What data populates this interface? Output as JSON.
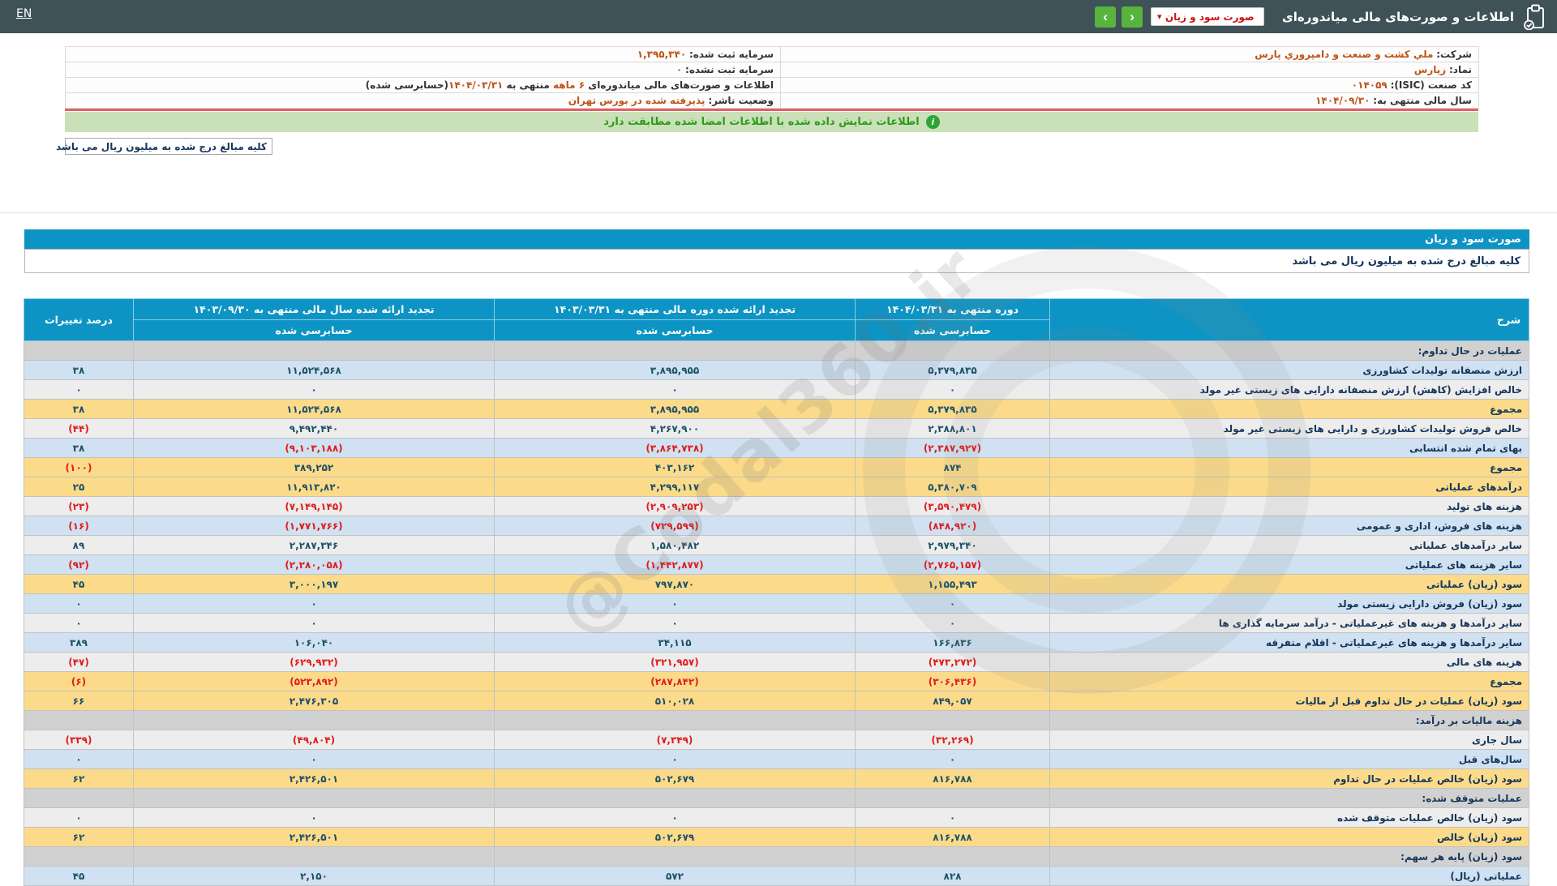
{
  "topbar": {
    "en_label": "EN",
    "title": "اطلاعات و صورت‌های مالی میاندوره‌ای",
    "report_select_value": "صورت سود و زیان",
    "nav_next": "›",
    "nav_prev": "‹",
    "select_arrow": "▾"
  },
  "company_info": {
    "rows": [
      {
        "r_label": "شرکت:",
        "r_value": "ملي کشت و صنعت و دامپروري پارس",
        "l_label": "سرمایه ثبت شده:",
        "l_value": "۱,۳۹۵,۳۴۰"
      },
      {
        "r_label": "نماد:",
        "r_value": "زپارس",
        "l_label": "سرمایه ثبت نشده:",
        "l_value": "۰"
      },
      {
        "r_label": "کد صنعت (ISIC):",
        "r_value": "۰۱۴۰۵۹"
      },
      {
        "r_label": "سال مالی منتهی به:",
        "r_value": "۱۴۰۴/۰۹/۳۰",
        "l_label": "وضعیت ناشر:",
        "l_value": "پذیرفته شده در بورس تهران"
      }
    ],
    "period_note": {
      "prefix": "اطلاعات و صورت‌های مالی میاندوره‌ای ",
      "duration": "۶ ماهه",
      "middle": " منتهی به ",
      "date": "۱۴۰۴/۰۳/۳۱",
      "suffix": "(حسابرسی شده)"
    }
  },
  "signature_bar": {
    "text": "اطلاعات نمایش داده شده با اطلاعات امضا شده مطابقت دارد",
    "icon": "i"
  },
  "units_note": "کلیه مبالغ درج شده به میلیون ریال می باشد",
  "statement": {
    "title": "صورت سود و زیان",
    "units_note": "کلیه مبالغ درج شده به میلیون ریال می باشد",
    "columns": {
      "description": "شرح",
      "current": {
        "title": "دوره منتهی به ۱۴۰۴/۰۳/۳۱",
        "sub": "حسابرسی شده"
      },
      "restated_period": {
        "title": "تجدید ارائه شده دوره مالی منتهی به ۱۴۰۳/۰۳/۳۱",
        "sub": "حسابرسی شده"
      },
      "restated_year": {
        "title": "تجدید ارائه شده سال مالی منتهی به ۱۴۰۳/۰۹/۳۰",
        "sub": "حسابرسی شده"
      },
      "pct_change": "درصد تغییرات"
    },
    "rows": [
      {
        "type": "section",
        "label": "عملیات در حال تداوم:",
        "current": "",
        "restated_period": "",
        "restated_year": "",
        "pct": ""
      },
      {
        "type": "blue",
        "label": "ارزش منصفانه تولیدات کشاورزی",
        "current": "۵,۳۷۹,۸۳۵",
        "restated_period": "۳,۸۹۵,۹۵۵",
        "restated_year": "۱۱,۵۲۴,۵۶۸",
        "pct": "۳۸"
      },
      {
        "type": "gray",
        "label": "خالص افزایش (کاهش) ارزش منصفانه دارایی های زیستی غیر مولد",
        "current": "۰",
        "restated_period": "۰",
        "restated_year": "۰",
        "pct": "۰"
      },
      {
        "type": "yellow",
        "label": "مجموع",
        "current": "۵,۳۷۹,۸۳۵",
        "restated_period": "۳,۸۹۵,۹۵۵",
        "restated_year": "۱۱,۵۲۴,۵۶۸",
        "pct": "۳۸"
      },
      {
        "type": "gray",
        "label": "خالص فروش تولیدات کشاورزی و دارایی های زیستی غیر مولد",
        "current": "۲,۳۸۸,۸۰۱",
        "restated_period": "۴,۲۶۷,۹۰۰",
        "restated_year": "۹,۴۹۲,۴۴۰",
        "pct": "(۴۴)"
      },
      {
        "type": "blue",
        "label": "بهای تمام شده انتسابی",
        "current": "(۲,۳۸۷,۹۲۷)",
        "restated_period": "(۳,۸۶۴,۷۳۸)",
        "restated_year": "(۹,۱۰۳,۱۸۸)",
        "pct": "۳۸"
      },
      {
        "type": "yellow",
        "label": "مجموع",
        "current": "۸۷۴",
        "restated_period": "۴۰۳,۱۶۲",
        "restated_year": "۳۸۹,۲۵۲",
        "pct": "(۱۰۰)"
      },
      {
        "type": "yellow",
        "label": "درآمدهای عملیاتی",
        "current": "۵,۳۸۰,۷۰۹",
        "restated_period": "۴,۲۹۹,۱۱۷",
        "restated_year": "۱۱,۹۱۳,۸۲۰",
        "pct": "۲۵"
      },
      {
        "type": "gray",
        "label": "هزینه های تولید",
        "current": "(۳,۵۹۰,۴۷۹)",
        "restated_period": "(۲,۹۰۹,۲۵۳)",
        "restated_year": "(۷,۱۴۹,۱۴۵)",
        "pct": "(۲۳)"
      },
      {
        "type": "blue",
        "label": "هزینه های فروش، اداری و عمومی",
        "current": "(۸۴۸,۹۲۰)",
        "restated_period": "(۷۲۹,۵۹۹)",
        "restated_year": "(۱,۷۷۱,۷۶۶)",
        "pct": "(۱۶)"
      },
      {
        "type": "gray",
        "label": "سایر درآمدهای عملیاتی",
        "current": "۲,۹۷۹,۳۴۰",
        "restated_period": "۱,۵۸۰,۴۸۲",
        "restated_year": "۲,۲۸۷,۳۴۶",
        "pct": "۸۹"
      },
      {
        "type": "blue",
        "label": "سایر هزینه های عملیاتی",
        "current": "(۲,۷۶۵,۱۵۷)",
        "restated_period": "(۱,۴۴۲,۸۷۷)",
        "restated_year": "(۲,۲۸۰,۰۵۸)",
        "pct": "(۹۲)"
      },
      {
        "type": "yellow",
        "label": "سود (زیان) عملیاتی",
        "current": "۱,۱۵۵,۴۹۳",
        "restated_period": "۷۹۷,۸۷۰",
        "restated_year": "۳,۰۰۰,۱۹۷",
        "pct": "۴۵"
      },
      {
        "type": "blue",
        "label": "سود (زیان) فروش دارایی زیستی مولد",
        "current": "۰",
        "restated_period": "۰",
        "restated_year": "۰",
        "pct": "۰"
      },
      {
        "type": "gray",
        "label": "سایر درآمدها و هزینه های غیرعملیاتی - درآمد سرمایه گذاری ها",
        "current": "۰",
        "restated_period": "۰",
        "restated_year": "۰",
        "pct": "۰"
      },
      {
        "type": "blue",
        "label": "سایر درآمدها و هزینه های غیرعملیاتی - اقلام متفرقه",
        "current": "۱۶۶,۸۳۶",
        "restated_period": "۳۴,۱۱۵",
        "restated_year": "۱۰۶,۰۴۰",
        "pct": "۳۸۹"
      },
      {
        "type": "gray",
        "label": "هزینه های مالی",
        "current": "(۴۷۳,۲۷۲)",
        "restated_period": "(۳۲۱,۹۵۷)",
        "restated_year": "(۶۲۹,۹۳۲)",
        "pct": "(۴۷)"
      },
      {
        "type": "yellow",
        "label": "مجموع",
        "current": "(۳۰۶,۴۳۶)",
        "restated_period": "(۲۸۷,۸۴۲)",
        "restated_year": "(۵۲۳,۸۹۲)",
        "pct": "(۶)"
      },
      {
        "type": "yellow",
        "label": "سود (زیان) عملیات در حال تداوم قبل از مالیات",
        "current": "۸۴۹,۰۵۷",
        "restated_period": "۵۱۰,۰۲۸",
        "restated_year": "۲,۴۷۶,۳۰۵",
        "pct": "۶۶"
      },
      {
        "type": "section",
        "label": "هزینه مالیات بر درآمد:",
        "current": "",
        "restated_period": "",
        "restated_year": "",
        "pct": ""
      },
      {
        "type": "gray",
        "label": "سال جاری",
        "current": "(۳۲,۲۶۹)",
        "restated_period": "(۷,۳۴۹)",
        "restated_year": "(۴۹,۸۰۴)",
        "pct": "(۳۳۹)"
      },
      {
        "type": "blue",
        "label": "سال‌های قبل",
        "current": "۰",
        "restated_period": "۰",
        "restated_year": "۰",
        "pct": "۰"
      },
      {
        "type": "yellow",
        "label": "سود (زیان) خالص عملیات در حال تداوم",
        "current": "۸۱۶,۷۸۸",
        "restated_period": "۵۰۲,۶۷۹",
        "restated_year": "۲,۴۲۶,۵۰۱",
        "pct": "۶۲"
      },
      {
        "type": "section",
        "label": "عملیات متوقف شده:",
        "current": "",
        "restated_period": "",
        "restated_year": "",
        "pct": ""
      },
      {
        "type": "gray",
        "label": "سود (زیان) خالص عملیات متوقف شده",
        "current": "۰",
        "restated_period": "۰",
        "restated_year": "۰",
        "pct": "۰"
      },
      {
        "type": "yellow",
        "label": "سود (زیان) خالص",
        "current": "۸۱۶,۷۸۸",
        "restated_period": "۵۰۲,۶۷۹",
        "restated_year": "۲,۴۲۶,۵۰۱",
        "pct": "۶۲"
      },
      {
        "type": "section",
        "label": "سود (زیان) پایه هر سهم:",
        "current": "",
        "restated_period": "",
        "restated_year": "",
        "pct": ""
      },
      {
        "type": "blue",
        "label": "عملیاتی (ریال)",
        "current": "۸۲۸",
        "restated_period": "۵۷۲",
        "restated_year": "۲,۱۵۰",
        "pct": "۴۵"
      }
    ]
  },
  "watermark": {
    "text": "@Codal360.ir"
  },
  "colors": {
    "topbar_bg": "#3e5257",
    "accent_blue": "#0d94c4",
    "nav_green": "#58b43c",
    "value_orange": "#bf5417",
    "negative_red": "#e11b1b",
    "signature_green_bg": "#c9e0b8",
    "row_yellow": "#fbdb8a",
    "row_blue": "#d0e1f1",
    "row_gray": "#ededed"
  }
}
